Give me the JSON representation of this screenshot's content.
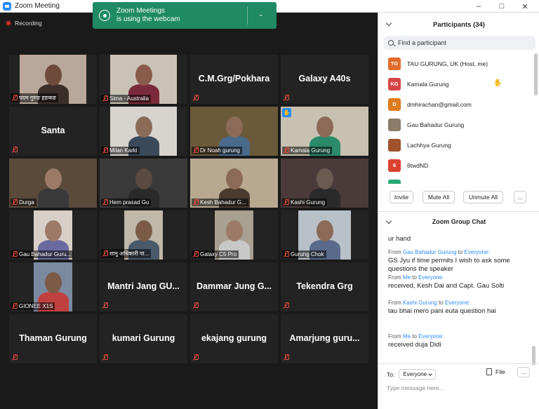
{
  "window": {
    "title": "Zoom Meeting"
  },
  "recording": {
    "label": "Recording"
  },
  "toast": {
    "line1": "Zoom Meetings",
    "line2": "is using the webcam"
  },
  "tiles": [
    {
      "label": "पदम गुरुङ हङकङ",
      "video": true
    },
    {
      "label": "Sima - Australia",
      "video": true
    },
    {
      "label": "C.M.Grg/Pokhara",
      "video": false
    },
    {
      "label": "Galaxy A40s",
      "video": false
    },
    {
      "label": "Santa",
      "video": false
    },
    {
      "label": "Milan Karki",
      "video": true
    },
    {
      "label": "Dr Noah gurung",
      "video": true
    },
    {
      "label": "Kamala Gurung",
      "video": true,
      "hand": true
    },
    {
      "label": "Durga",
      "video": true
    },
    {
      "label": "Hem prasad Gu",
      "video": true
    },
    {
      "label": "Kesh Bahadur G...",
      "video": true
    },
    {
      "label": "Kashi Gurung",
      "video": true
    },
    {
      "label": "Gau Bahadur Guru...",
      "video": true
    },
    {
      "label": "शानु अधिकारी पा...",
      "video": true
    },
    {
      "label": "Galaxy C5 Pro",
      "video": true
    },
    {
      "label": "Gurung Chok",
      "video": true
    },
    {
      "label": "GIONEE X1S",
      "video": true
    },
    {
      "label": "Mantri Jang GU...",
      "video": false
    },
    {
      "label": "Dammar Jung G...",
      "video": false
    },
    {
      "label": "Tekendra Grg",
      "video": false
    },
    {
      "label": "Thaman Gurung",
      "video": false
    },
    {
      "label": "kumari Gurung",
      "video": false
    },
    {
      "label": "ekajang gurung",
      "video": false
    },
    {
      "label": "Amarjung guru...",
      "video": false
    }
  ],
  "participants": {
    "header": "Participants (34)",
    "search_placeholder": "Find a participant",
    "items": [
      {
        "initials": "TG",
        "name": "TAU GURUNG, UK (Host, me)",
        "color": "#e26a2c",
        "mic_off": false,
        "cam_off": true,
        "hand": false,
        "rec": false
      },
      {
        "initials": "KG",
        "name": "Kamala Gurung",
        "color": "#d64545",
        "mic_off": true,
        "cam_off": false,
        "hand": true,
        "rec": false
      },
      {
        "initials": "D",
        "name": "dmhirachan@gmail.com",
        "color": "#e07a1f",
        "mic_off": false,
        "cam_off": false,
        "hand": false,
        "rec": false
      },
      {
        "initials": "",
        "name": "Gau Bahadur Gurung",
        "color": "#8c7b6b",
        "mic_off": false,
        "cam_off": false,
        "hand": false,
        "rec": false
      },
      {
        "initials": "",
        "name": "Lachhya Gurung",
        "color": "#a0522d",
        "mic_off": false,
        "cam_off": false,
        "hand": false,
        "rec": true
      },
      {
        "initials": "6",
        "name": "6twdND",
        "color": "#d9432f",
        "mic_off": true,
        "cam_off": false,
        "hand": false,
        "rec": false
      },
      {
        "initials": "",
        "name": "",
        "color": "#2aa876",
        "mic_off": true,
        "cam_off": true,
        "hand": false,
        "rec": false
      }
    ],
    "buttons": {
      "invite": "Invite",
      "mute_all": "Mute All",
      "unmute_all": "Unmute All",
      "more": "..."
    }
  },
  "chat": {
    "header": "Zoom Group Chat",
    "first_text": "ur hand",
    "messages": [
      {
        "from_prefix": "From",
        "sender": "Gau Bahadur Gurung",
        "to_word": "to",
        "recipient": "Everyone:",
        "text": "GS Jyu if time permits I wish to ask some questions the speaker"
      },
      {
        "from_prefix": "From",
        "sender": "Me",
        "to_word": "to",
        "recipient": "Everyone:",
        "text": "received, Kesh Dai and Capt. Gau Solti"
      },
      {
        "from_prefix": "From",
        "sender": "Kashi Gurung",
        "to_word": "to",
        "recipient": "Everyone:",
        "text": "tau bhai mero pani euta question hai"
      },
      {
        "from_prefix": "From",
        "sender": "Me",
        "to_word": "to",
        "recipient": "Everyone:",
        "text": "received duja Didi"
      }
    ],
    "to_label": "To:",
    "to_value": "Everyone",
    "file_label": "File",
    "more_label": "...",
    "input_placeholder": "Type message here..."
  }
}
